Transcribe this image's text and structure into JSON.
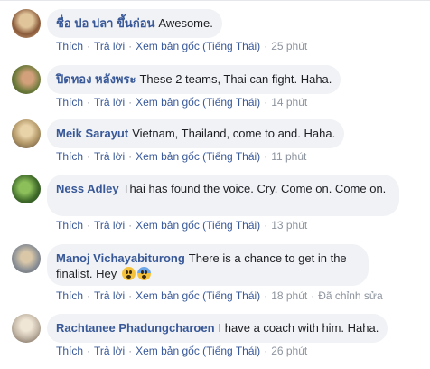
{
  "actions": {
    "like": "Thích",
    "reply": "Trả lời",
    "see_original": "Xem bản gốc (Tiếng Thái)",
    "separator": "·"
  },
  "comments": [
    {
      "author": "ชื่อ ปอ ปลา ขึ้นก่อน",
      "text": "Awesome.",
      "time": "25 phút",
      "edited": "",
      "avatar_colors": [
        "#c9a27a",
        "#8a5a3a"
      ]
    },
    {
      "author": "ปิดทอง หลังพระ",
      "text": "These 2 teams, Thai can fight. Haha.",
      "time": "14 phút",
      "edited": "",
      "avatar_colors": [
        "#6b7a3a",
        "#c88a5a"
      ]
    },
    {
      "author": "Meik Sarayut",
      "text": "Vietnam, Thailand, come to and. Haha.",
      "time": "11 phút",
      "edited": "",
      "avatar_colors": [
        "#b59a6a",
        "#5a4a3a"
      ]
    },
    {
      "author": "Ness Adley",
      "text": "Thai has found the voice. Cry. Come on. Come on.",
      "line2": "",
      "time": "13 phút",
      "edited": "",
      "avatar_colors": [
        "#3f6a2a",
        "#8cbf5a"
      ]
    },
    {
      "author": "Manoj Vichayabiturong",
      "text": "There is a chance to get in the finalist. Hey",
      "time": "18 phút",
      "edited": "Đã chỉnh sửa",
      "avatar_colors": [
        "#8a8f95",
        "#d9c7a8"
      ]
    },
    {
      "author": "Rachtanee Phadungcharoen",
      "text": "I have a coach with him. Haha.",
      "time": "26 phút",
      "edited": "",
      "avatar_colors": [
        "#c4b8a8",
        "#6a5a4a"
      ]
    }
  ]
}
